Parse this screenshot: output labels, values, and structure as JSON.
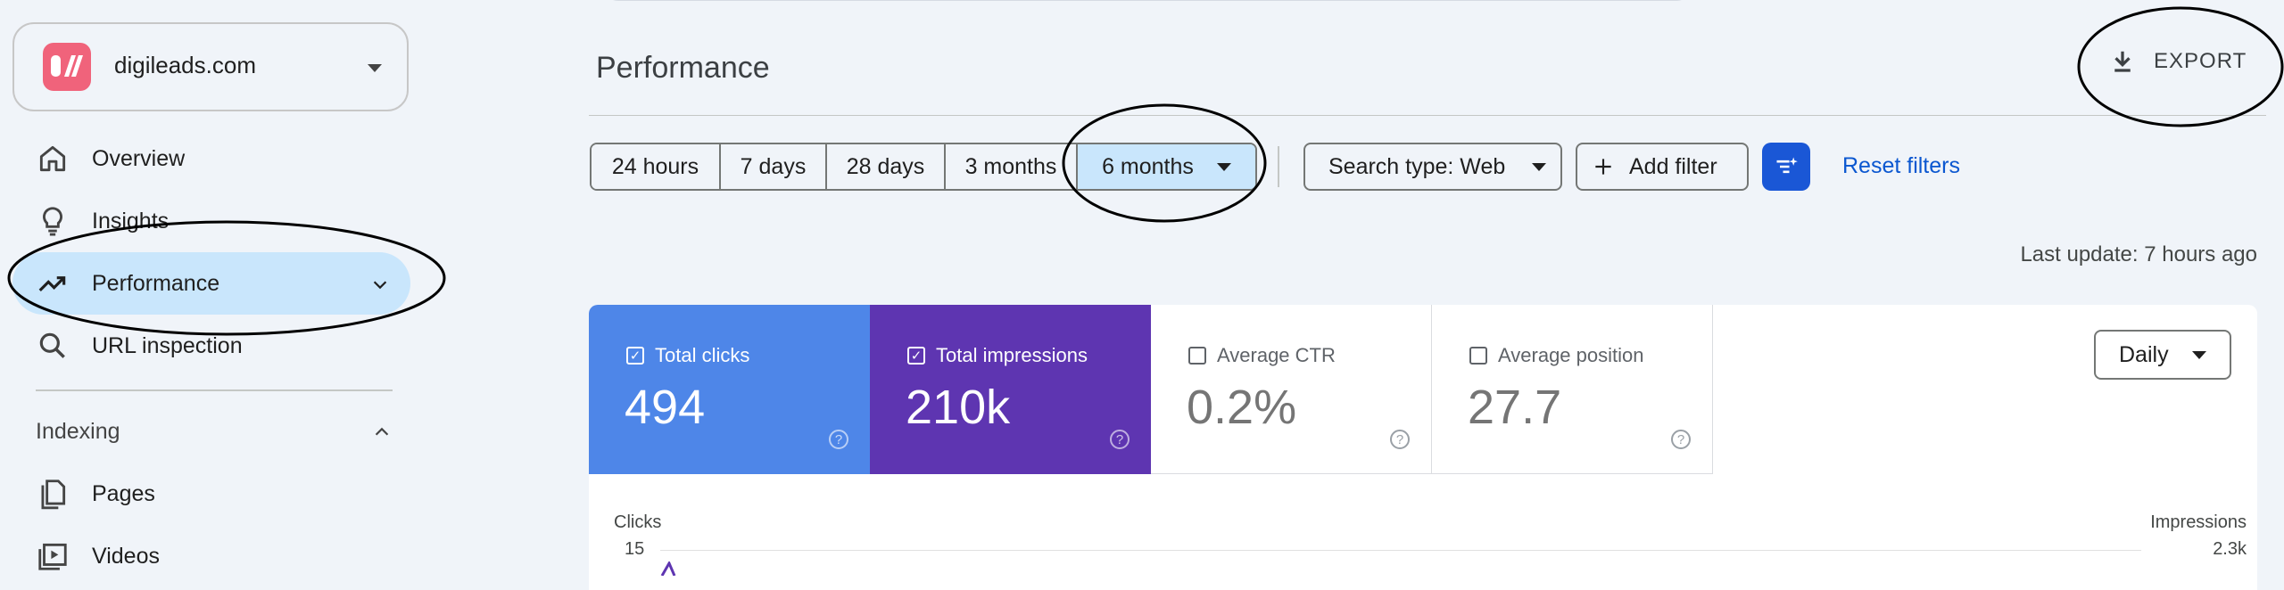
{
  "property": {
    "name": "digileads.com"
  },
  "nav": {
    "items": [
      {
        "label": "Overview",
        "icon": "home-icon"
      },
      {
        "label": "Insights",
        "icon": "lightbulb-icon"
      },
      {
        "label": "Performance",
        "icon": "trending-up-icon",
        "active": true
      },
      {
        "label": "URL inspection",
        "icon": "search-icon"
      }
    ],
    "indexing": {
      "label": "Indexing",
      "items": [
        {
          "label": "Pages",
          "icon": "pages-icon"
        },
        {
          "label": "Videos",
          "icon": "video-icon"
        }
      ]
    }
  },
  "header": {
    "title": "Performance",
    "export_label": "EXPORT"
  },
  "filters": {
    "date_ranges": [
      "24 hours",
      "7 days",
      "28 days",
      "3 months",
      "6 months"
    ],
    "selected_range": "6 months",
    "search_type": "Search type: Web",
    "add_filter": "Add filter",
    "reset": "Reset filters"
  },
  "last_update": "Last update: 7 hours ago",
  "metrics": [
    {
      "label": "Total clicks",
      "value": "494",
      "checked": true,
      "color": "#4e86e8"
    },
    {
      "label": "Total impressions",
      "value": "210k",
      "checked": true,
      "color": "#5e35b1"
    },
    {
      "label": "Average CTR",
      "value": "0.2%",
      "checked": false,
      "color": "#ffffff"
    },
    {
      "label": "Average position",
      "value": "27.7",
      "checked": false,
      "color": "#ffffff"
    }
  ],
  "granularity": "Daily",
  "chart": {
    "left_axis_label": "Clicks",
    "right_axis_label": "Impressions",
    "left_max": "15",
    "right_max": "2.3k"
  },
  "colors": {
    "accent": "#0b57d0",
    "nav_active": "#c9e6fc",
    "background": "#f0f4f9"
  }
}
